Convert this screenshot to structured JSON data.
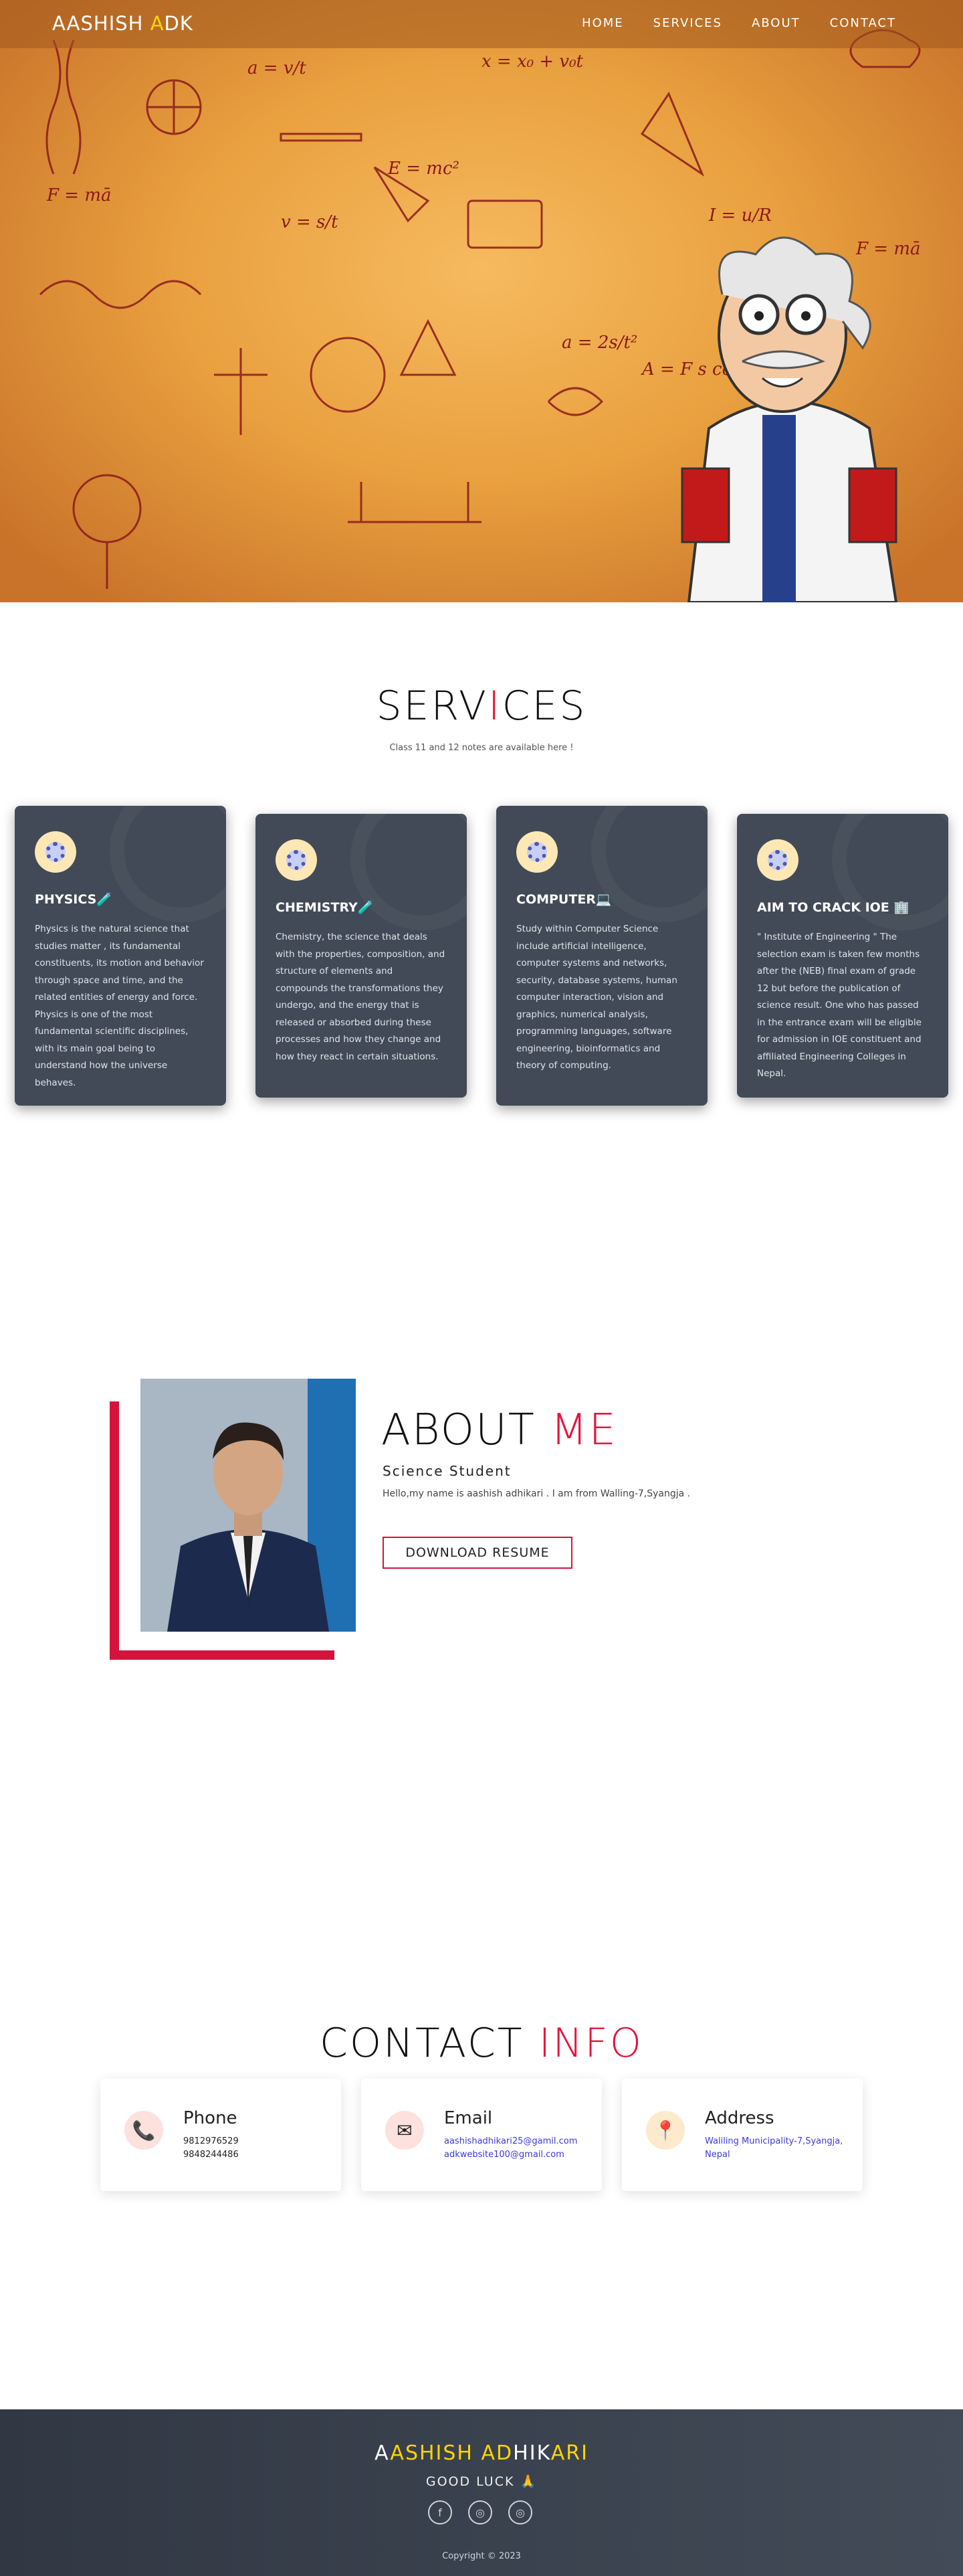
{
  "nav": {
    "brand_a": "AASHISH ",
    "brand_b": "A",
    "brand_c": "DK",
    "links": [
      "HOME",
      "SERVICES",
      "ABOUT",
      "CONTACT"
    ]
  },
  "services": {
    "title_a": "SERV",
    "title_b": "I",
    "title_c": "CES",
    "subtitle": "Class 11 and 12 notes are available here !",
    "cards": [
      {
        "title": "PHYSICS🧪",
        "text": "Physics is the natural science that studies matter , its fundamental constituents, its motion and behavior through space and time, and the related entities of energy and force. Physics is one of the most fundamental scientific disciplines, with its main goal being to understand how the universe behaves."
      },
      {
        "title": "CHEMISTRY🧪",
        "text": "Chemistry, the science that deals with the properties, composition, and structure of elements and compounds the transformations they undergo, and the energy that is released or absorbed during these processes and how they change and how they react in certain situations."
      },
      {
        "title": "COMPUTER💻",
        "text": "Study within Computer Science include artificial intelligence, computer systems and networks, security, database systems, human computer interaction, vision and graphics, numerical analysis, programming languages, software engineering, bioinformatics and theory of computing."
      },
      {
        "title": "AIM TO CRACK IOE 🏢",
        "text": "\" Institute of Engineering \" The selection exam is taken few months after the (NEB) final exam of grade 12 but before the publication of science result. One who has passed in the entrance exam will be eligible for admission in IOE constituent and affiliated Engineering Colleges in Nepal."
      }
    ]
  },
  "about": {
    "title_a": "ABOUT ",
    "title_b": "ME",
    "role": "Science Student",
    "desc": "Hello,my name is aashish adhikari . I am from Walling-7,Syangja .",
    "button": "DOWNLOAD RESUME"
  },
  "contact": {
    "title_a": "CONTACT ",
    "title_b": "INFO",
    "cards": [
      {
        "title": "Phone",
        "icon": "phone-icon",
        "lines": [
          "9812976529",
          "9848244486"
        ]
      },
      {
        "title": "Email",
        "icon": "envelope-icon",
        "lines": [
          "aashishadhikari25@gamil.com",
          "adkwebsite100@gmail.com"
        ]
      },
      {
        "title": "Address",
        "icon": "map-pin-icon",
        "lines": [
          "Waliling Municipality-7,Syangja,",
          "Nepal"
        ]
      }
    ]
  },
  "footer": {
    "name_a": "A",
    "name_b": "ASHISH AD",
    "name_c": "HIK",
    "name_d": "ARI",
    "subtitle": "GOOD LUCK 🙏",
    "socials": [
      "facebook-icon",
      "instagram-icon",
      "instagram-icon"
    ],
    "copyright": "Copyright © 2023"
  },
  "colors": {
    "accent": "#e3153c",
    "brand_yellow": "#ffd400",
    "card_bg": "#424a57"
  }
}
